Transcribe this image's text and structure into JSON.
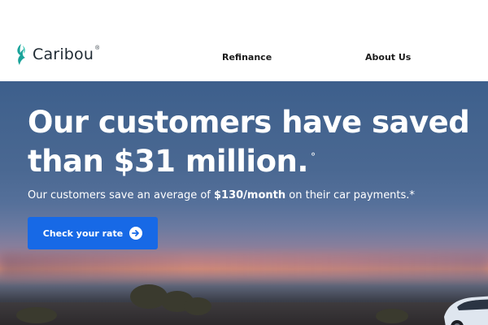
{
  "header": {
    "brand_name": "Caribou",
    "brand_reg": "®",
    "nav": [
      {
        "label": "Refinance"
      },
      {
        "label": "About Us"
      }
    ]
  },
  "hero": {
    "headline_line1": "Our customers have saved",
    "headline_line2": "than $31 million.",
    "headline_mark": "°",
    "subhead_pre": "Our customers save an average of ",
    "subhead_bold": "$130/month",
    "subhead_post": " on their car payments.*",
    "cta_label": "Check your rate",
    "cta_icon": "arrow-right-circle-icon"
  },
  "colors": {
    "cta": "#1769e6",
    "brand_mark": "#1aa39a",
    "header_bg": "#ffffff"
  }
}
